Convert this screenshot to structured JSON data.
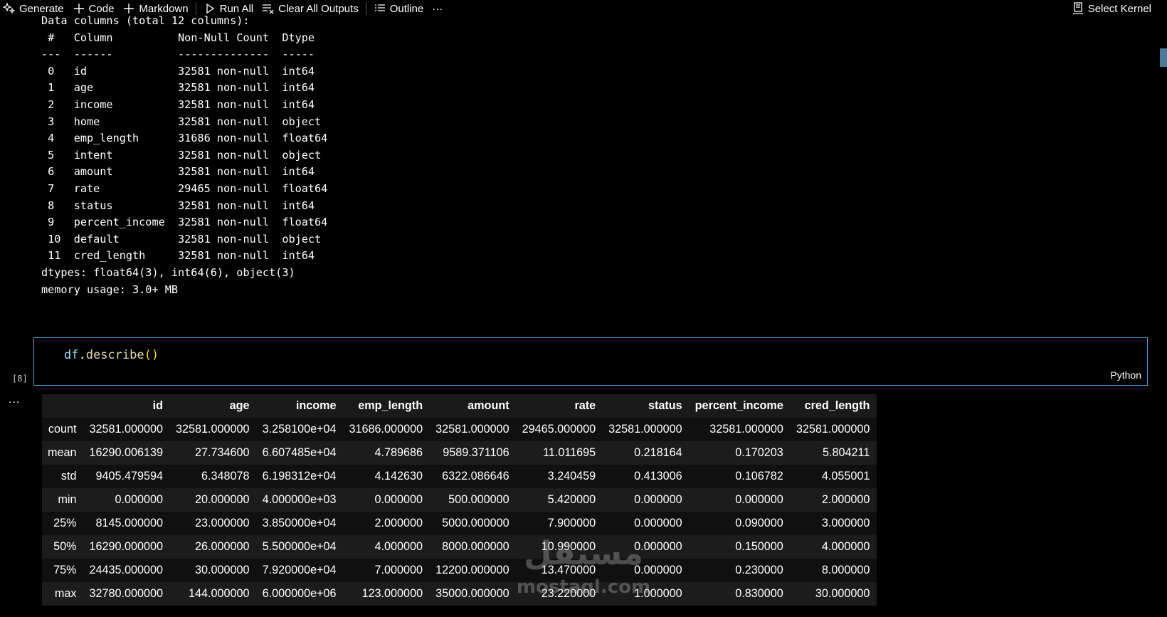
{
  "toolbar": {
    "generate": "Generate",
    "code": "Code",
    "markdown": "Markdown",
    "run_all": "Run All",
    "clear_outputs": "Clear All Outputs",
    "outline": "Outline",
    "more": "···",
    "select_kernel": "Select Kernel"
  },
  "info_output": {
    "lines": [
      "Data columns (total 12 columns):",
      " #   Column          Non-Null Count  Dtype  ",
      "---  ------          --------------  -----  ",
      " 0   id              32581 non-null  int64  ",
      " 1   age             32581 non-null  int64  ",
      " 2   income          32581 non-null  int64  ",
      " 3   home            32581 non-null  object ",
      " 4   emp_length      31686 non-null  float64",
      " 5   intent          32581 non-null  object ",
      " 6   amount          32581 non-null  int64  ",
      " 7   rate            29465 non-null  float64",
      " 8   status          32581 non-null  int64  ",
      " 9   percent_income  32581 non-null  float64",
      " 10  default         32581 non-null  object ",
      " 11  cred_length     32581 non-null  int64  ",
      "dtypes: float64(3), int64(6), object(3)",
      "memory usage: 3.0+ MB"
    ]
  },
  "cell": {
    "obj": "df",
    "dot": ".",
    "method": "describe",
    "paren_open": "(",
    "paren_close": ")",
    "language": "Python",
    "exec_count": "[8]"
  },
  "output_dots": "...",
  "table": {
    "columns": [
      "",
      "id",
      "age",
      "income",
      "emp_length",
      "amount",
      "rate",
      "status",
      "percent_income",
      "cred_length"
    ],
    "rows": [
      [
        "count",
        "32581.000000",
        "32581.000000",
        "3.258100e+04",
        "31686.000000",
        "32581.000000",
        "29465.000000",
        "32581.000000",
        "32581.000000",
        "32581.000000"
      ],
      [
        "mean",
        "16290.006139",
        "27.734600",
        "6.607485e+04",
        "4.789686",
        "9589.371106",
        "11.011695",
        "0.218164",
        "0.170203",
        "5.804211"
      ],
      [
        "std",
        "9405.479594",
        "6.348078",
        "6.198312e+04",
        "4.142630",
        "6322.086646",
        "3.240459",
        "0.413006",
        "0.106782",
        "4.055001"
      ],
      [
        "min",
        "0.000000",
        "20.000000",
        "4.000000e+03",
        "0.000000",
        "500.000000",
        "5.420000",
        "0.000000",
        "0.000000",
        "2.000000"
      ],
      [
        "25%",
        "8145.000000",
        "23.000000",
        "3.850000e+04",
        "2.000000",
        "5000.000000",
        "7.900000",
        "0.000000",
        "0.090000",
        "3.000000"
      ],
      [
        "50%",
        "16290.000000",
        "26.000000",
        "5.500000e+04",
        "4.000000",
        "8000.000000",
        "10.990000",
        "0.000000",
        "0.150000",
        "4.000000"
      ],
      [
        "75%",
        "24435.000000",
        "30.000000",
        "7.920000e+04",
        "7.000000",
        "12200.000000",
        "13.470000",
        "0.000000",
        "0.230000",
        "8.000000"
      ],
      [
        "max",
        "32780.000000",
        "144.000000",
        "6.000000e+06",
        "123.000000",
        "35000.000000",
        "23.220000",
        "1.000000",
        "0.830000",
        "30.000000"
      ]
    ]
  },
  "watermark": {
    "arabic": "مستقل",
    "latin": "mostaql.com"
  },
  "colors": {
    "background": "#000000",
    "cell_border": "#4f9bd4",
    "code_var": "#9cdcfe",
    "code_fn": "#dcdcaa",
    "code_paren": "#ffd700"
  }
}
